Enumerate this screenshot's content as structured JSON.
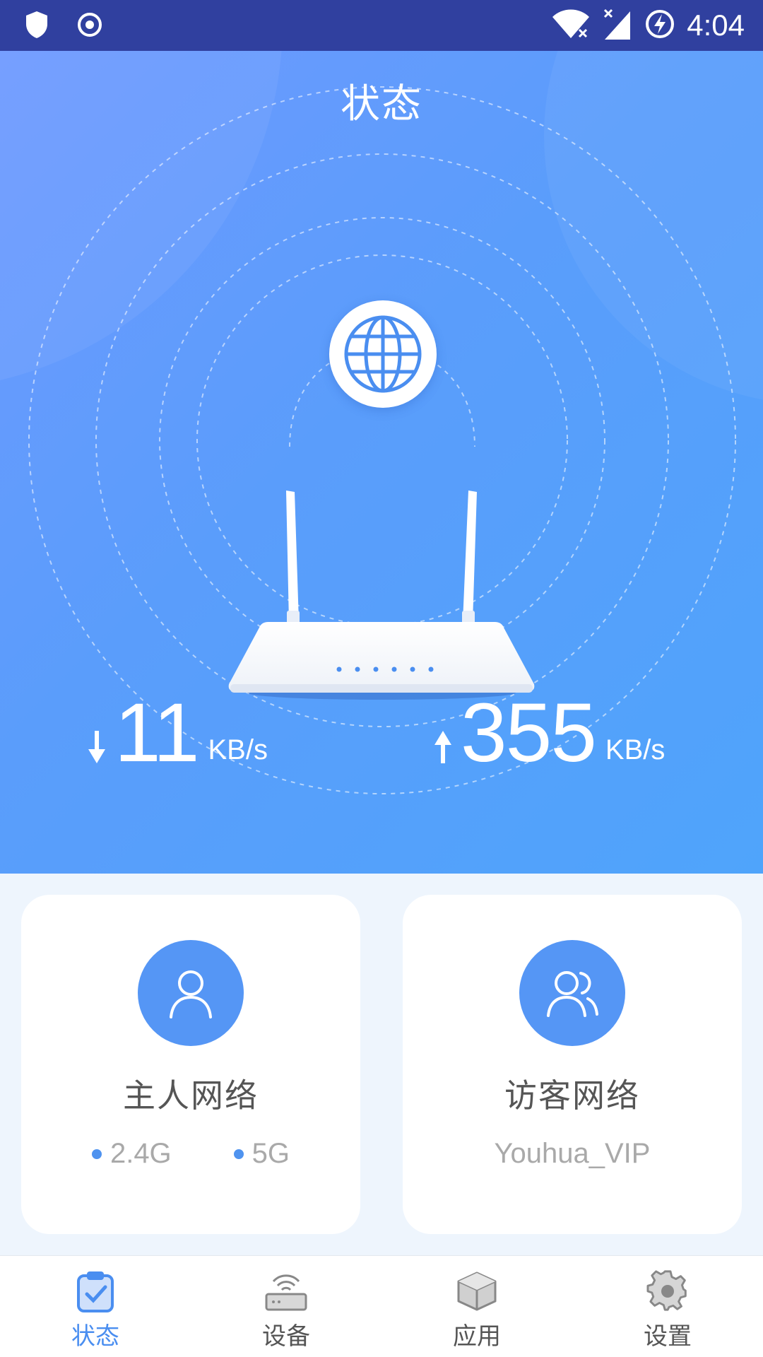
{
  "status_bar": {
    "time": "4:04"
  },
  "hero": {
    "title": "状态",
    "download": {
      "value": "11",
      "unit": "KB/s"
    },
    "upload": {
      "value": "355",
      "unit": "KB/s"
    }
  },
  "cards": {
    "host": {
      "title": "主人网络",
      "bands": [
        "2.4G",
        "5G"
      ]
    },
    "guest": {
      "title": "访客网络",
      "ssid": "Youhua_VIP"
    }
  },
  "bottom_nav": {
    "active": "状态",
    "items": [
      {
        "label": "状态",
        "icon": "status-clipboard-icon"
      },
      {
        "label": "设备",
        "icon": "router-device-icon"
      },
      {
        "label": "应用",
        "icon": "cube-app-icon"
      },
      {
        "label": "设置",
        "icon": "gear-icon"
      }
    ]
  },
  "colors": {
    "status_bar": "#30409f",
    "accent": "#4a8ef0",
    "avatar_bg": "#5596f5"
  }
}
